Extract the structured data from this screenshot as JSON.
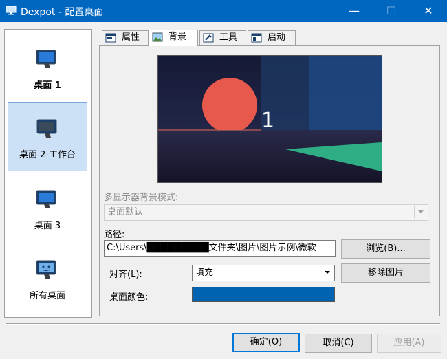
{
  "window": {
    "title": "Dexpot - 配置桌面",
    "minimize": "—",
    "maximize": "☐",
    "close": "✕"
  },
  "desktops": [
    {
      "label": "桌面 1"
    },
    {
      "label": "桌面 2-工作台"
    },
    {
      "label": "桌面 3"
    },
    {
      "label": "所有桌面"
    }
  ],
  "tabs": [
    {
      "label": "属性"
    },
    {
      "label": "背景"
    },
    {
      "label": "工具"
    },
    {
      "label": "启动"
    }
  ],
  "preview": {
    "number": "1"
  },
  "monitor_mode": {
    "label": "多显示器背景模式:",
    "value": "桌面默认"
  },
  "path": {
    "label": "路径:",
    "value": "C:\\Users\\█████████文件夹\\图片\\图片示例\\微软",
    "browse_label": "浏览(B)..."
  },
  "align": {
    "label": "对齐(L):",
    "value": "填充",
    "remove_label": "移除图片"
  },
  "color": {
    "label": "桌面颜色:",
    "value": "#0063b1"
  },
  "footer": {
    "ok_label": "确定(O)",
    "cancel_label": "取消(C)",
    "apply_label": "应用(A)"
  }
}
